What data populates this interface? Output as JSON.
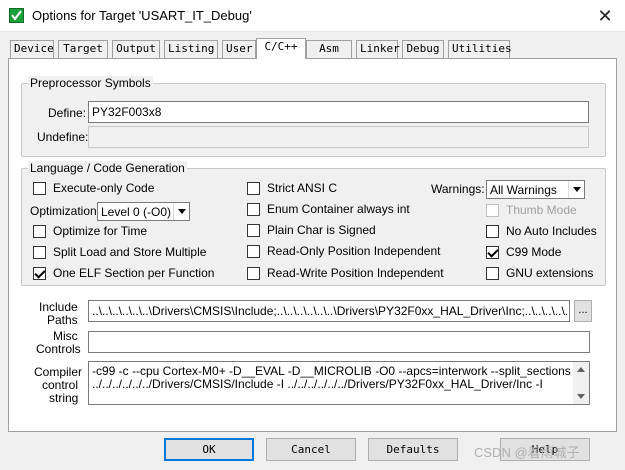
{
  "window": {
    "title": "Options for Target 'USART_IT_Debug'",
    "close_glyph": "✕"
  },
  "tabs": [
    {
      "label": "Device"
    },
    {
      "label": "Target"
    },
    {
      "label": "Output"
    },
    {
      "label": "Listing"
    },
    {
      "label": "User"
    },
    {
      "label": "C/C++",
      "active": true
    },
    {
      "label": "Asm"
    },
    {
      "label": "Linker"
    },
    {
      "label": "Debug"
    },
    {
      "label": "Utilities"
    }
  ],
  "preprocessor": {
    "group_title": "Preprocessor Symbols",
    "define_label": "Define:",
    "define_value": "PY32F003x8",
    "undefine_label": "Undefine:",
    "undefine_value": ""
  },
  "language": {
    "group_title": "Language / Code Generation",
    "execute_only": {
      "label": "Execute-only Code",
      "checked": false
    },
    "optimization_label": "Optimization:",
    "optimization_value": "Level 0 (-O0)",
    "optimize_time": {
      "label": "Optimize for Time",
      "checked": false
    },
    "split_load": {
      "label": "Split Load and Store Multiple",
      "checked": false
    },
    "one_elf": {
      "label": "One ELF Section per Function",
      "checked": true
    },
    "strict_ansi": {
      "label": "Strict ANSI C",
      "checked": false
    },
    "enum_container": {
      "label": "Enum Container always int",
      "checked": false
    },
    "plain_char": {
      "label": "Plain Char is Signed",
      "checked": false
    },
    "ro_pos_indep": {
      "label": "Read-Only Position Independent",
      "checked": false
    },
    "rw_pos_indep": {
      "label": "Read-Write Position Independent",
      "checked": false
    },
    "warnings_label": "Warnings:",
    "warnings_value": "All Warnings",
    "thumb_mode": {
      "label": "Thumb Mode",
      "checked": false,
      "disabled": true
    },
    "no_auto_includes": {
      "label": "No Auto Includes",
      "checked": false
    },
    "c99_mode": {
      "label": "C99 Mode",
      "checked": true
    },
    "gnu_extensions": {
      "label": "GNU extensions",
      "checked": false
    }
  },
  "paths": {
    "include_label_1": "Include",
    "include_label_2": "Paths",
    "include_value": "..\\..\\..\\..\\..\\..\\Drivers\\CMSIS\\Include;..\\..\\..\\..\\..\\..\\Drivers\\PY32F0xx_HAL_Driver\\Inc;..\\..\\..\\..\\..\\..\\..\\..",
    "browse_label": "...",
    "misc_label_1": "Misc",
    "misc_label_2": "Controls",
    "misc_value": "",
    "compiler_label_1": "Compiler",
    "compiler_label_2": "control",
    "compiler_label_3": "string",
    "compiler_line_1": "-c99 -c --cpu Cortex-M0+ -D__EVAL -D__MICROLIB -O0 --apcs=interwork --split_sections -I",
    "compiler_line_2": "../../../../../../Drivers/CMSIS/Include -I ../../../../../../Drivers/PY32F0xx_HAL_Driver/Inc -I"
  },
  "buttons": {
    "ok": "OK",
    "cancel": "Cancel",
    "defaults": "Defaults",
    "help": "Help"
  },
  "watermark": "CSDN @着雨城子"
}
